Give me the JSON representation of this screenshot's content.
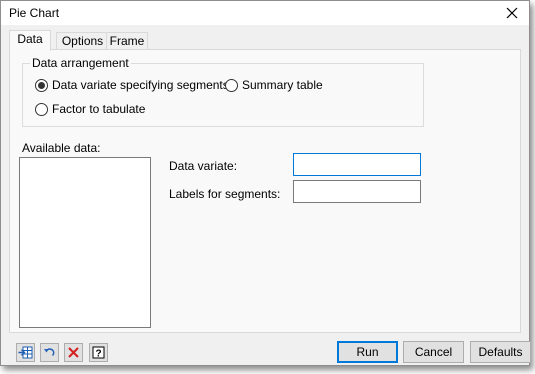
{
  "window": {
    "title": "Pie Chart",
    "close_glyph": "✕"
  },
  "tabs": [
    {
      "label": "Data",
      "active": true
    },
    {
      "label": "Options",
      "active": false
    },
    {
      "label": "Frame",
      "active": false
    }
  ],
  "data_arrangement": {
    "legend": "Data arrangement",
    "options": [
      {
        "label": "Data variate specifying segments",
        "selected": true
      },
      {
        "label": "Summary table",
        "selected": false
      },
      {
        "label": "Factor to tabulate",
        "selected": false
      }
    ]
  },
  "available_data": {
    "label": "Available data:",
    "items": []
  },
  "fields": {
    "data_variate": {
      "label": "Data variate:",
      "value": ""
    },
    "labels_for_segments": {
      "label": "Labels for segments:",
      "value": ""
    }
  },
  "toolbar": {
    "icons": [
      {
        "name": "save-to-spreadsheet-icon"
      },
      {
        "name": "restore-icon"
      },
      {
        "name": "clear-icon"
      },
      {
        "name": "help-icon",
        "glyph": "?"
      }
    ],
    "buttons": {
      "run": "Run",
      "cancel": "Cancel",
      "defaults": "Defaults"
    }
  },
  "colors": {
    "dialog_bg": "#f0f0f0",
    "panel_bg": "#f9f9f9",
    "focus_border": "#0078d7",
    "clear_icon_red": "#d42020",
    "icon_blue": "#1e5fb4"
  }
}
